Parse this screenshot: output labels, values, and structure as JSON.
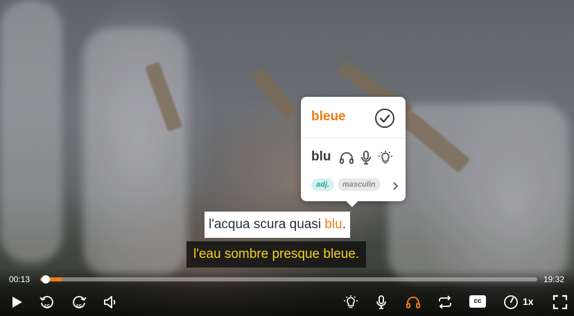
{
  "subtitles": {
    "original_before": "l'acqua scura quasi ",
    "original_highlight": "blu",
    "original_after": ".",
    "translation": "l'eau sombre presque bleue."
  },
  "word_popup": {
    "translation": "bleue",
    "word": "blu",
    "tags": {
      "pos": "adj.",
      "gender": "masculin"
    },
    "icons": [
      "check-circle-icon",
      "headphones-icon",
      "microphone-icon",
      "lightbulb-icon",
      "chevron-right-icon"
    ]
  },
  "player": {
    "current_time": "00:13",
    "total_time": "19:32",
    "progress_fraction": 0.011,
    "buffered_fraction": 0.045,
    "speed": "1x",
    "cc_label": "cc",
    "accent_color": "#f07a12",
    "subtitle_color": "#f6d21a",
    "icons": [
      "play-icon",
      "previous-subtitle-icon",
      "next-subtitle-icon",
      "volume-icon",
      "lightbulb-icon",
      "microphone-icon",
      "headphones-icon",
      "repeat-icon",
      "cc-icon",
      "speed-gauge-icon",
      "fullscreen-icon"
    ]
  }
}
